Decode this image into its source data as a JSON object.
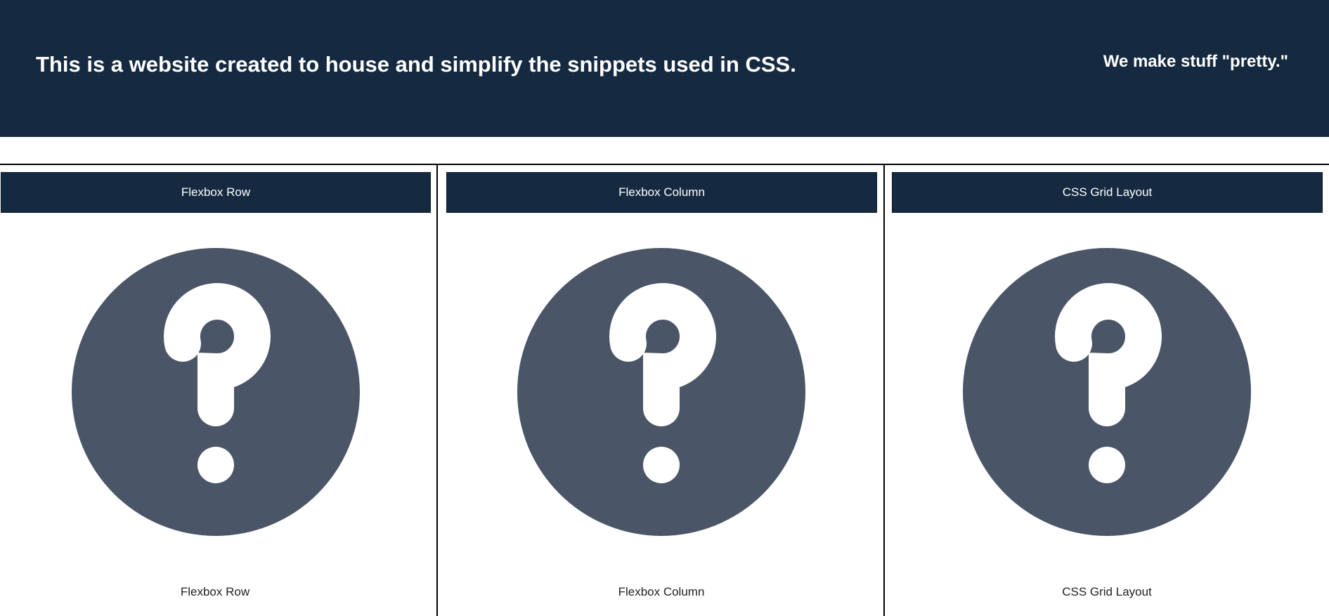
{
  "header": {
    "title": "This is a website created to house and simplify the snippets used in CSS.",
    "tagline": "We make stuff \"pretty.\""
  },
  "cards": [
    {
      "button_label": "Flexbox Row",
      "caption": "Flexbox Row",
      "icon": "question-circle-icon"
    },
    {
      "button_label": "Flexbox Column",
      "caption": "Flexbox Column",
      "icon": "question-circle-icon"
    },
    {
      "button_label": "CSS Grid Layout",
      "caption": "CSS Grid Layout",
      "icon": "question-circle-icon"
    }
  ],
  "colors": {
    "header_bg": "#152a40",
    "icon_fill": "#4a5567",
    "text_light": "#ffffff"
  }
}
